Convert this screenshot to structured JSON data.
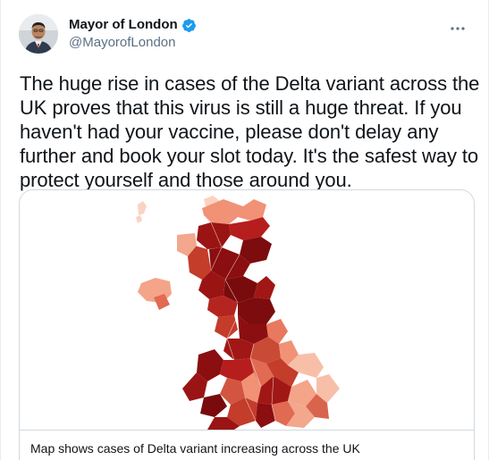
{
  "author": {
    "display_name": "Mayor of London",
    "handle": "@MayorofLondon",
    "verified": true,
    "avatar_icon": "profile-photo"
  },
  "tweet": {
    "text": "The huge rise in cases of the Delta variant across the UK proves that this virus is still a huge threat. If you haven't had your vaccine, please don't delay any further and book your slot today. It's the safest way to protect yourself and those around you."
  },
  "card": {
    "caption": "Map shows cases of Delta variant increasing across the UK",
    "map_icon": "uk-map-image"
  },
  "colors": {
    "accent": "#1d9bf0",
    "map_dark": "#8b0e10",
    "map_mid": "#c43c2a",
    "map_light": "#ef8a6e",
    "map_pale": "#fbd2c2"
  },
  "icons": {
    "more": "more-horizontal-icon",
    "verified": "verified-badge-icon"
  }
}
